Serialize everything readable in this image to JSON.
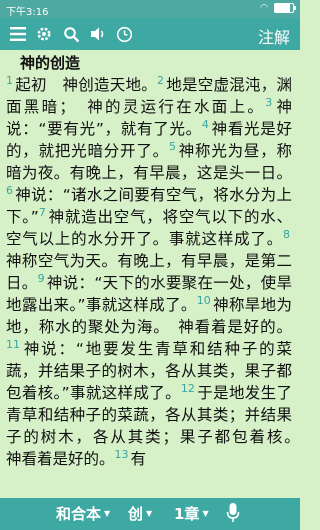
{
  "status": {
    "time": "下午3:16"
  },
  "toolbar": {
    "annotation_label": "注解"
  },
  "chapter": {
    "title": "神的创造",
    "verses": [
      {
        "num": "1",
        "text": "起初　神创造天地。"
      },
      {
        "num": "2",
        "text": "地是空虚混沌，渊面黑暗；　神的灵运行在水面上。"
      },
      {
        "num": "3",
        "text": "神说：“要有光”，就有了光。"
      },
      {
        "num": "4",
        "text": "神看光是好的，就把光暗分开了。"
      },
      {
        "num": "5",
        "text": "神称光为昼，称暗为夜。有晚上，有早晨，这是头一日。"
      },
      {
        "num": "6",
        "text": "神说：“诸水之间要有空气，将水分为上下。”"
      },
      {
        "num": "7",
        "text": "神就造出空气，将空气以下的水、空气以上的水分开了。事就这样成了。"
      },
      {
        "num": "8",
        "text": "神称空气为天。有晚上，有早晨，是第二日。"
      },
      {
        "num": "9",
        "text": "神说：“天下的水要聚在一处，使旱地露出来。”事就这样成了。"
      },
      {
        "num": "10",
        "text": "神称旱地为地，称水的聚处为海。　神看着是好的。"
      },
      {
        "num": "11",
        "text": "神说：“地要发生青草和结种子的菜蔬，并结果子的树木，各从其类，果子都包着核。”事就这样成了。"
      },
      {
        "num": "12",
        "text": "于是地发生了青草和结种子的菜蔬，各从其类；并结果子的树木，各从其类；果子都包着核。　神看着是好的。"
      },
      {
        "num": "13",
        "text": "有"
      }
    ]
  },
  "bottom_bar": {
    "version": "和合本",
    "book": "创",
    "chapter": "1章"
  }
}
